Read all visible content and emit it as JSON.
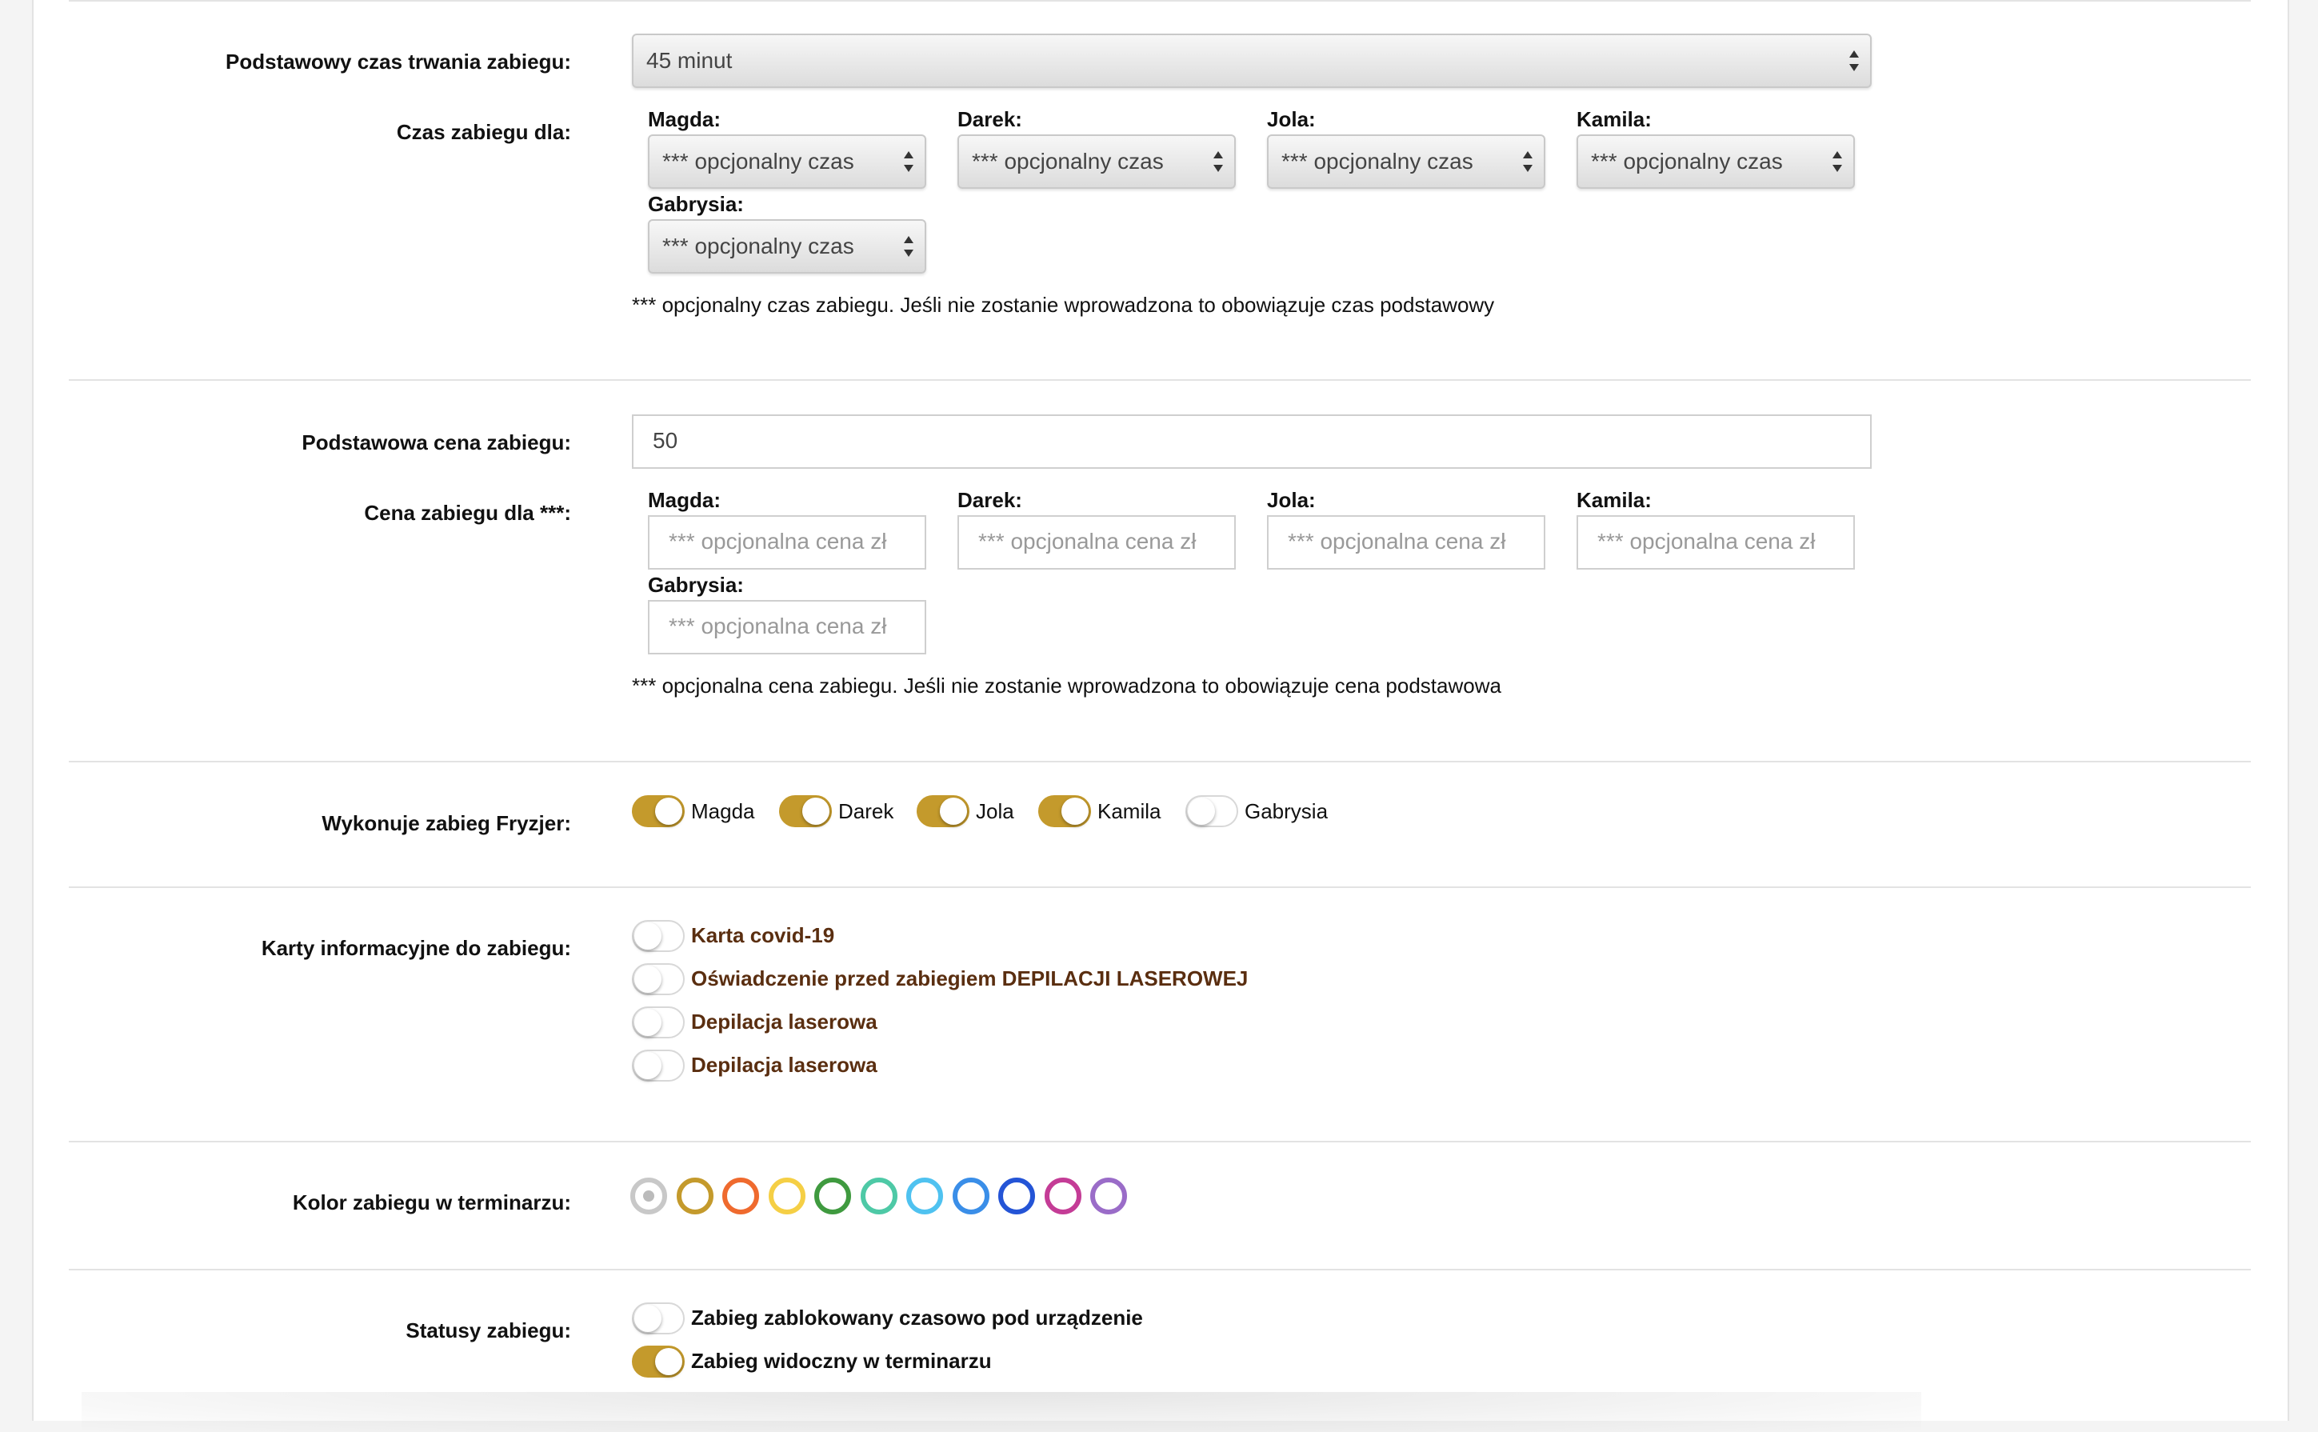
{
  "duration": {
    "label": "Podstawowy czas trwania zabiegu:",
    "value": "45 minut",
    "per_label": "Czas zabiegu dla:",
    "staff": [
      {
        "name": "Magda:",
        "value": "*** opcjonalny czas"
      },
      {
        "name": "Darek:",
        "value": "*** opcjonalny czas"
      },
      {
        "name": "Jola:",
        "value": "*** opcjonalny czas"
      },
      {
        "name": "Kamila:",
        "value": "*** opcjonalny czas"
      },
      {
        "name": "Gabrysia:",
        "value": "*** opcjonalny czas"
      }
    ],
    "note": "*** opcjonalny czas zabiegu. Jeśli nie zostanie wprowadzona to obowiązuje czas podstawowy"
  },
  "price": {
    "label": "Podstawowa cena zabiegu:",
    "value": "50",
    "per_label": "Cena zabiegu dla ***:",
    "staff": [
      {
        "name": "Magda:",
        "placeholder": "*** opcjonalna cena zł"
      },
      {
        "name": "Darek:",
        "placeholder": "*** opcjonalna cena zł"
      },
      {
        "name": "Jola:",
        "placeholder": "*** opcjonalna cena zł"
      },
      {
        "name": "Kamila:",
        "placeholder": "*** opcjonalna cena zł"
      },
      {
        "name": "Gabrysia:",
        "placeholder": "*** opcjonalna cena zł"
      }
    ],
    "note": "*** opcjonalna cena zabiegu. Jeśli nie zostanie wprowadzona to obowiązuje cena podstawowa"
  },
  "performers": {
    "label": "Wykonuje zabieg Fryzjer:",
    "items": [
      {
        "name": "Magda",
        "on": true
      },
      {
        "name": "Darek",
        "on": true
      },
      {
        "name": "Jola",
        "on": true
      },
      {
        "name": "Kamila",
        "on": true
      },
      {
        "name": "Gabrysia",
        "on": false
      }
    ]
  },
  "cards": {
    "label": "Karty informacyjne do zabiegu:",
    "items": [
      {
        "name": "Karta covid-19",
        "on": false
      },
      {
        "name": "Oświadczenie przed zabiegiem DEPILACJI LASEROWEJ",
        "on": false
      },
      {
        "name": "Depilacja laserowa",
        "on": false
      },
      {
        "name": "Depilacja laserowa",
        "on": false
      }
    ]
  },
  "color": {
    "label": "Kolor zabiegu w terminarzu:",
    "selected": 0,
    "swatches": [
      "#c8c8c8",
      "#c49a2c",
      "#ef6a2e",
      "#f5cf45",
      "#3f9a3f",
      "#4ec9a6",
      "#4fc2f0",
      "#3a8ee8",
      "#2454d6",
      "#c43c96",
      "#9a6cc8"
    ]
  },
  "statuses": {
    "label": "Statusy zabiegu:",
    "items": [
      {
        "name": "Zabieg zablokowany czasowo pod urządzenie",
        "on": false
      },
      {
        "name": "Zabieg widoczny w terminarzu",
        "on": true
      }
    ]
  },
  "colors": {
    "accent": "#c49a2c",
    "card_link": "#5a2e10"
  }
}
